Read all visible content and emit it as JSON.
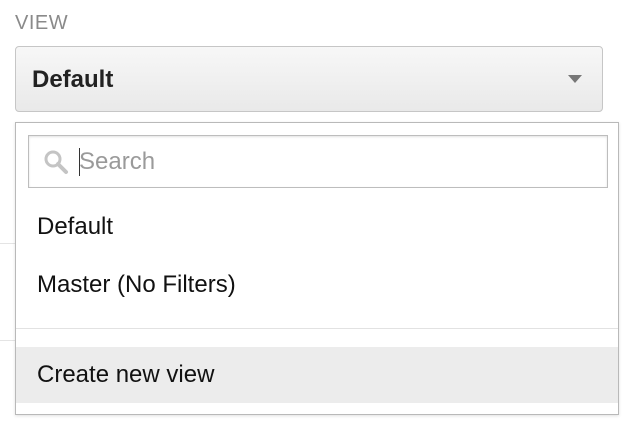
{
  "section": {
    "label": "VIEW"
  },
  "select": {
    "selected_value": "Default"
  },
  "dropdown": {
    "search": {
      "placeholder": "Search",
      "value": ""
    },
    "options": [
      {
        "label": "Default"
      },
      {
        "label": "Master (No Filters)"
      }
    ],
    "action": {
      "label": "Create new view"
    }
  },
  "colors": {
    "label_gray": "#8a8a8a",
    "highlight_bg": "#ececec",
    "border": "#b9b9b9"
  },
  "icons": [
    "search-icon",
    "caret-down-icon"
  ]
}
